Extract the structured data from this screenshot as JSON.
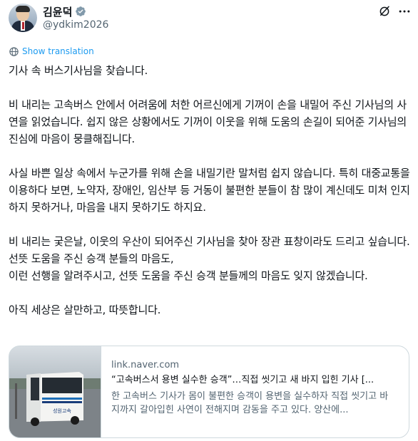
{
  "author": {
    "display_name": "김윤덕",
    "handle": "@ydkim2026",
    "verified": true
  },
  "actions": {
    "grok_icon": "grok-slash-icon",
    "more_icon": "more-dots-icon"
  },
  "translate": {
    "label": "Show translation",
    "icon": "globe-icon"
  },
  "post": {
    "paragraphs": [
      "기사 속 버스기사님을 찾습니다.",
      "비 내리는 고속버스 안에서 어려움에 처한 어르신에게 기꺼이 손을 내밀어 주신 기사님의 사연을 읽었습니다. 쉽지 않은 상황에서도 기꺼이 이웃을 위해 도움의 손길이 되어준 기사님의 진심에 마음이 뭉클해집니다.",
      "사실 바쁜 일상 속에서 누군가를 위해 손을 내밀기란 말처럼 쉽지 않습니다. 특히 대중교통을 이용하다 보면, 노약자, 장애인, 임산부 등 거동이 불편한 분들이 참 많이 계신데도 미처 인지하지 못하거나, 마음을 내지 못하기도 하지요.",
      "비 내리는 궂은날, 이웃의 우산이 되어주신 기사님을 찾아 장관 표창이라도 드리고 싶습니다.\n선뜻 도움을 주신 승객 분들의 마음도,\n이런 선행을 알려주시고, 선뜻 도움을 주신 승객 분들께의 마음도 잊지 않겠습니다.",
      "아직 세상은 살만하고, 따뜻합니다."
    ]
  },
  "link_card": {
    "domain": "link.naver.com",
    "title": "“고속버스서 용변 실수한 승객”…직접 씻기고 새 바지 입힌 기사 [...",
    "description": "한 고속버스 기사가 몸이 불편한 승객이 용변을 실수하자 직접 씻기고 바지까지 갈아입힌 사연이 전해지며 감동을 주고 있다. 양산에...",
    "thumbnail": "bus-photo",
    "bus_side_text": "성원고속"
  },
  "colors": {
    "accent": "#1d9bf0",
    "text": "#0f1419",
    "muted": "#536471",
    "border": "#cfd9de"
  }
}
